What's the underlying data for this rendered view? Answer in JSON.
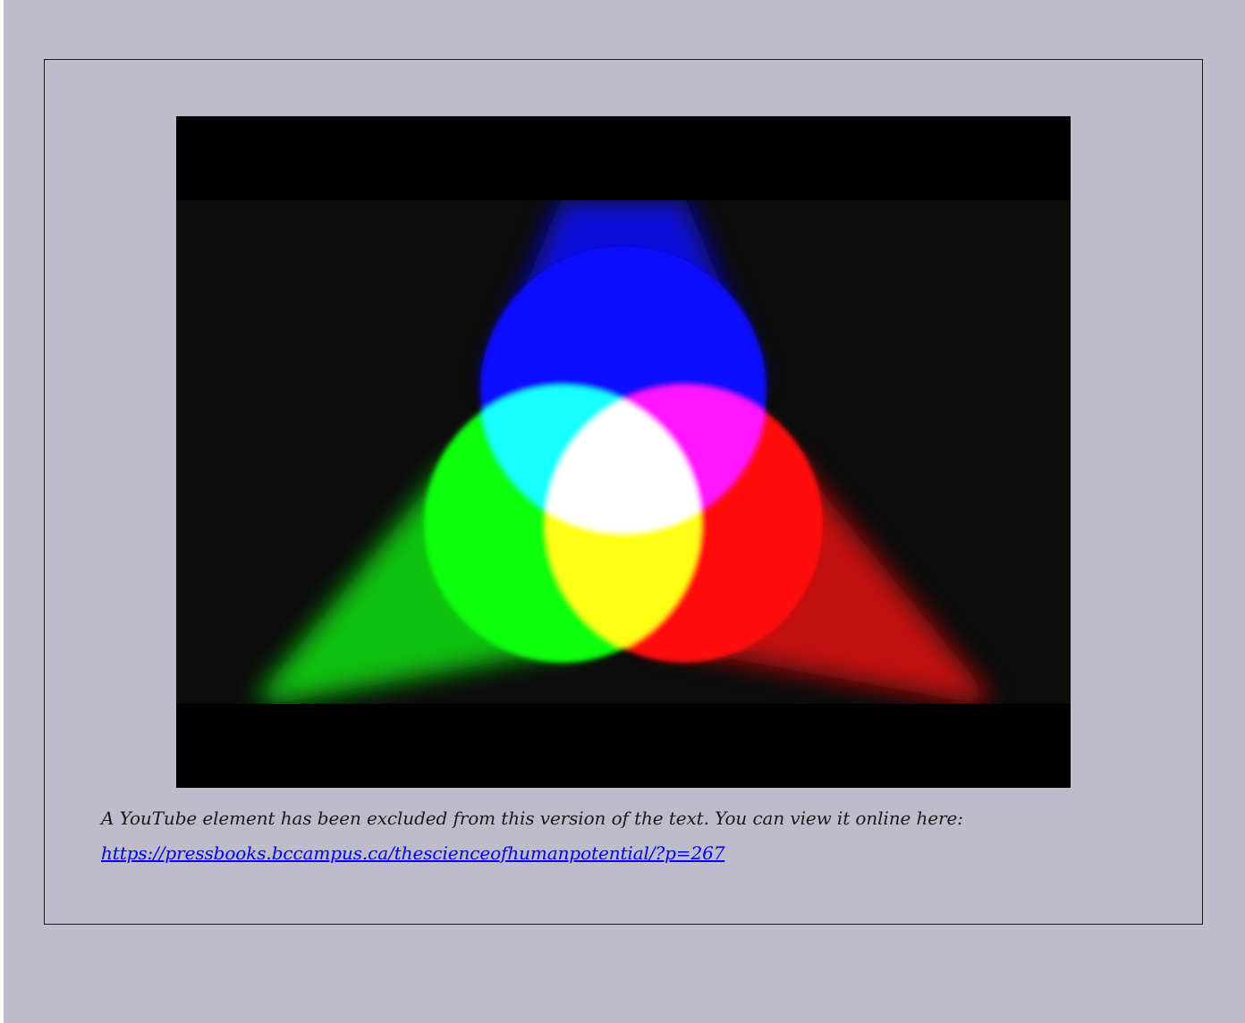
{
  "embed": {
    "caption_text": "A YouTube element has been excluded from this version of the text. You can view it online here:",
    "link_text": "https://pressbooks.bccampus.ca/thescienceofhumanpotential/?p=267"
  },
  "colors": {
    "page_background": "#bebccb",
    "frame_border": "#1a1a1a",
    "link": "#0000ee",
    "video_letterbox": "#000000",
    "video_background": "#0c0c0c",
    "light_red": "#ff0d0d",
    "light_green": "#0dff0d",
    "light_blue": "#0d0dff"
  }
}
